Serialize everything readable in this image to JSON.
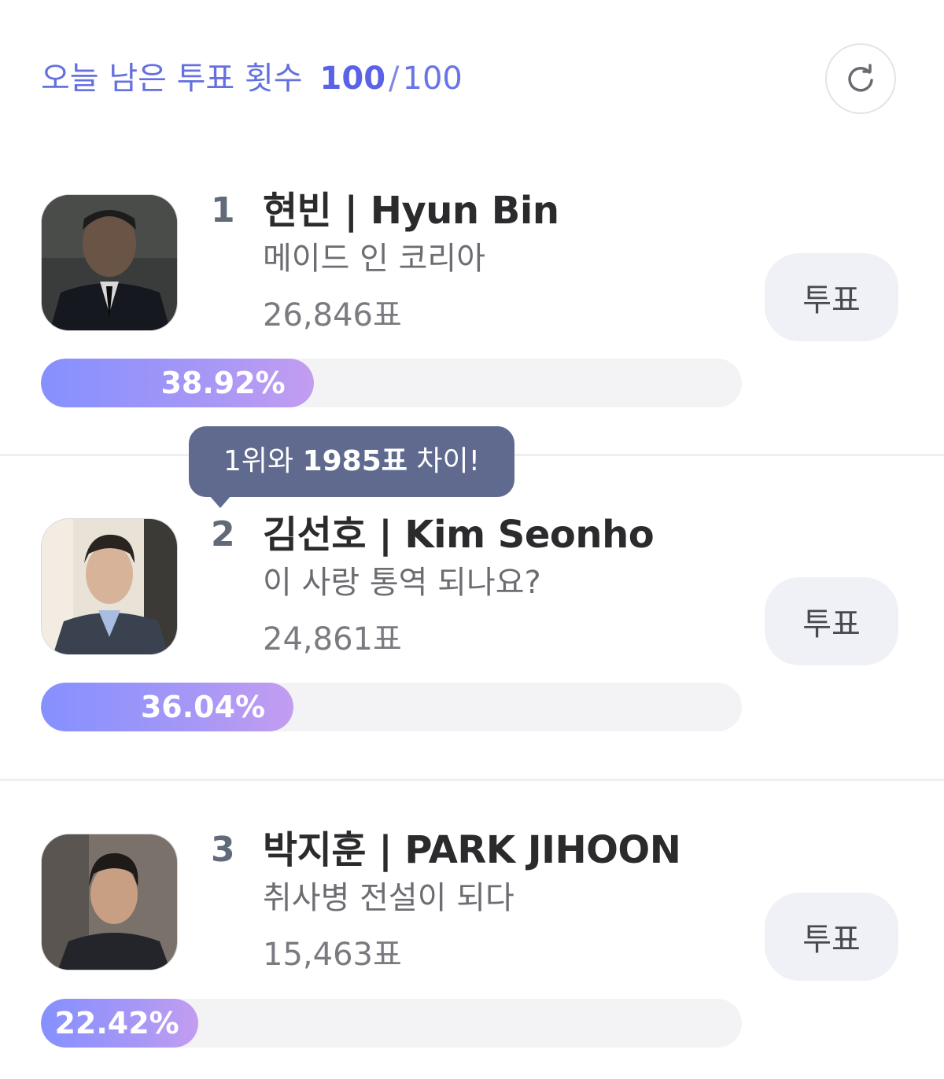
{
  "header": {
    "label": "오늘 남은 투표 횟수",
    "remaining": "100",
    "separator": "/",
    "total": "100",
    "refresh_icon": "refresh-icon"
  },
  "tooltip": {
    "prefix": "1위와 ",
    "gap": "1985표",
    "suffix": " 차이!"
  },
  "candidates": [
    {
      "rank": "1",
      "name": "현빈 | Hyun Bin",
      "title": "메이드 인 코리아",
      "votes": "26,846표",
      "percent_label": "38.92%",
      "percent": 38.92,
      "vote_label": "투표"
    },
    {
      "rank": "2",
      "name": "김선호 | Kim Seonho",
      "title": "이 사랑 통역 되나요?",
      "votes": "24,861표",
      "percent_label": "36.04%",
      "percent": 36.04,
      "vote_label": "투표"
    },
    {
      "rank": "3",
      "name": "박지훈 | PARK JIHOON",
      "title": "취사병 전설이 되다",
      "votes": "15,463표",
      "percent_label": "22.42%",
      "percent": 22.42,
      "vote_label": "투표"
    }
  ],
  "colors": {
    "accent": "#5a63e8",
    "bar_start": "#8590ff",
    "bar_end": "#c39df0",
    "tooltip_bg": "#5f6a8e"
  }
}
